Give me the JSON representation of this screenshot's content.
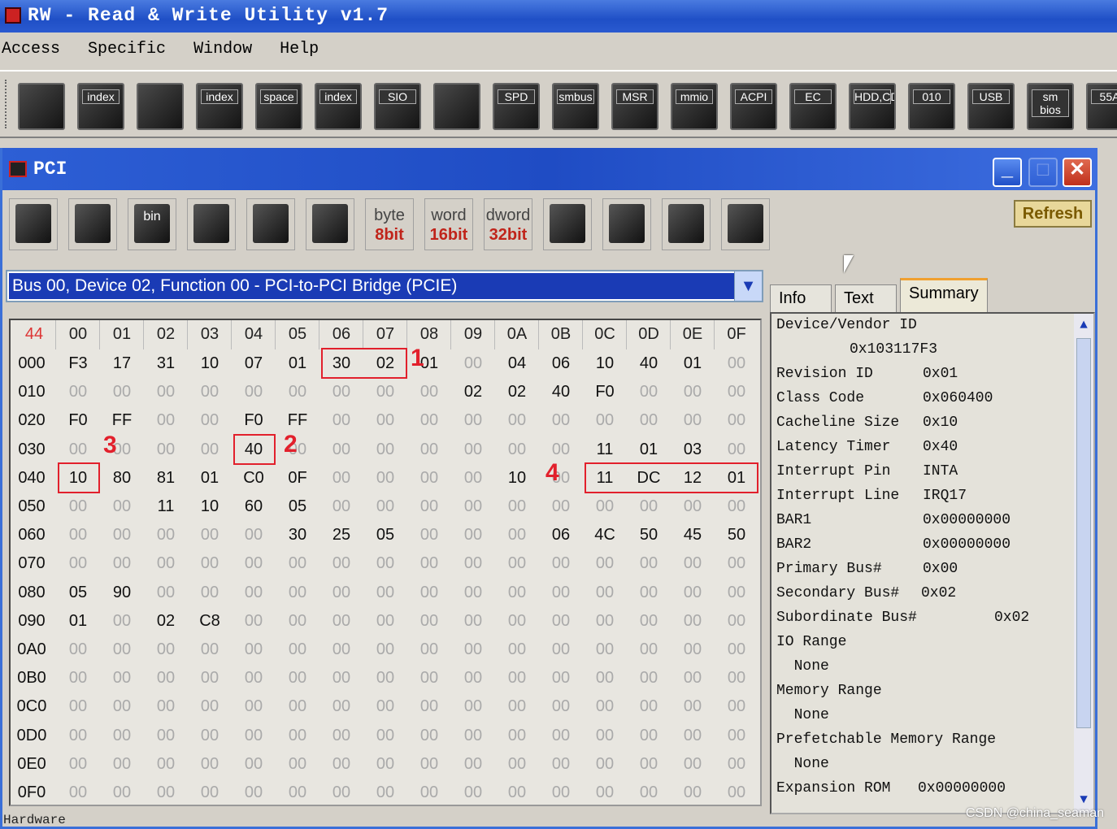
{
  "app": {
    "title": "RW - Read & Write Utility v1.7"
  },
  "menu": [
    "Access",
    "Specific",
    "Window",
    "Help"
  ],
  "toolbar": [
    {
      "label": "",
      "icon": "pci-card-icon"
    },
    {
      "label": "index",
      "icon": "index-icon"
    },
    {
      "label": "",
      "icon": "memory-icon"
    },
    {
      "label": "index",
      "icon": "index-icon"
    },
    {
      "label": "space",
      "icon": "io-space-icon"
    },
    {
      "label": "index",
      "icon": "io-index-icon"
    },
    {
      "label": "SIO",
      "icon": "sio-icon"
    },
    {
      "label": "",
      "icon": "cmos-icon"
    },
    {
      "label": "SPD",
      "icon": "spd-icon"
    },
    {
      "label": "smbus",
      "icon": "smbus-icon"
    },
    {
      "label": "MSR",
      "icon": "msr-icon"
    },
    {
      "label": "mmio",
      "icon": "mmio-icon"
    },
    {
      "label": "ACPI",
      "icon": "acpi-icon"
    },
    {
      "label": "EC",
      "icon": "ec-icon"
    },
    {
      "label": "HDD,CD",
      "icon": "hdd-icon"
    },
    {
      "label": "010",
      "icon": "file-icon"
    },
    {
      "label": "USB",
      "icon": "usb-icon"
    },
    {
      "label": "sm bios",
      "icon": "smbios-icon"
    },
    {
      "label": "55A",
      "icon": "more-icon"
    }
  ],
  "pci_window": {
    "title": "PCI",
    "toolbar": [
      {
        "l1": "",
        "l2": "",
        "icon": "save-icon"
      },
      {
        "l1": "",
        "l2": "",
        "icon": "save-all-icon"
      },
      {
        "l1": "bin",
        "l2": "",
        "icon": "save-bin-icon"
      },
      {
        "l1": "",
        "l2": "",
        "icon": "load-icon"
      },
      {
        "l1": "",
        "l2": "",
        "icon": "find-icon"
      },
      {
        "l1": "",
        "l2": "",
        "icon": "compare-icon"
      },
      {
        "l1": "byte",
        "l2": "8bit",
        "icon": ""
      },
      {
        "l1": "word",
        "l2": "16bit",
        "icon": ""
      },
      {
        "l1": "dword",
        "l2": "32bit",
        "icon": ""
      },
      {
        "l1": "",
        "l2": "",
        "icon": "tree-icon"
      },
      {
        "l1": "",
        "l2": "",
        "icon": "gear-icon"
      },
      {
        "l1": "",
        "l2": "",
        "icon": "info-icon"
      },
      {
        "l1": "",
        "l2": "",
        "icon": "help-icon"
      }
    ],
    "refresh_label": "Refresh",
    "device": "Bus 00, Device 02, Function 00 -  PCI-to-PCI Bridge (PCIE)",
    "grid": {
      "corner": "44",
      "cols": [
        "00",
        "01",
        "02",
        "03",
        "04",
        "05",
        "06",
        "07",
        "08",
        "09",
        "0A",
        "0B",
        "0C",
        "0D",
        "0E",
        "0F"
      ],
      "rows": [
        {
          "addr": "000",
          "v": [
            "F3",
            "17",
            "31",
            "10",
            "07",
            "01",
            "30",
            "02",
            "01",
            "00",
            "04",
            "06",
            "10",
            "40",
            "01",
            "00"
          ]
        },
        {
          "addr": "010",
          "v": [
            "00",
            "00",
            "00",
            "00",
            "00",
            "00",
            "00",
            "00",
            "00",
            "02",
            "02",
            "40",
            "F0",
            "00",
            "00",
            "00"
          ]
        },
        {
          "addr": "020",
          "v": [
            "F0",
            "FF",
            "00",
            "00",
            "F0",
            "FF",
            "00",
            "00",
            "00",
            "00",
            "00",
            "00",
            "00",
            "00",
            "00",
            "00"
          ]
        },
        {
          "addr": "030",
          "v": [
            "00",
            "00",
            "00",
            "00",
            "40",
            "00",
            "00",
            "00",
            "00",
            "00",
            "00",
            "00",
            "11",
            "01",
            "03",
            "00"
          ]
        },
        {
          "addr": "040",
          "v": [
            "10",
            "80",
            "81",
            "01",
            "C0",
            "0F",
            "00",
            "00",
            "00",
            "00",
            "10",
            "00",
            "11",
            "DC",
            "12",
            "01"
          ]
        },
        {
          "addr": "050",
          "v": [
            "00",
            "00",
            "11",
            "10",
            "60",
            "05",
            "00",
            "00",
            "00",
            "00",
            "00",
            "00",
            "00",
            "00",
            "00",
            "00"
          ]
        },
        {
          "addr": "060",
          "v": [
            "00",
            "00",
            "00",
            "00",
            "00",
            "30",
            "25",
            "05",
            "00",
            "00",
            "00",
            "06",
            "4C",
            "50",
            "45",
            "50"
          ]
        },
        {
          "addr": "070",
          "v": [
            "00",
            "00",
            "00",
            "00",
            "00",
            "00",
            "00",
            "00",
            "00",
            "00",
            "00",
            "00",
            "00",
            "00",
            "00",
            "00"
          ]
        },
        {
          "addr": "080",
          "v": [
            "05",
            "90",
            "00",
            "00",
            "00",
            "00",
            "00",
            "00",
            "00",
            "00",
            "00",
            "00",
            "00",
            "00",
            "00",
            "00"
          ]
        },
        {
          "addr": "090",
          "v": [
            "01",
            "00",
            "02",
            "C8",
            "00",
            "00",
            "00",
            "00",
            "00",
            "00",
            "00",
            "00",
            "00",
            "00",
            "00",
            "00"
          ]
        },
        {
          "addr": "0A0",
          "v": [
            "00",
            "00",
            "00",
            "00",
            "00",
            "00",
            "00",
            "00",
            "00",
            "00",
            "00",
            "00",
            "00",
            "00",
            "00",
            "00"
          ]
        },
        {
          "addr": "0B0",
          "v": [
            "00",
            "00",
            "00",
            "00",
            "00",
            "00",
            "00",
            "00",
            "00",
            "00",
            "00",
            "00",
            "00",
            "00",
            "00",
            "00"
          ]
        },
        {
          "addr": "0C0",
          "v": [
            "00",
            "00",
            "00",
            "00",
            "00",
            "00",
            "00",
            "00",
            "00",
            "00",
            "00",
            "00",
            "00",
            "00",
            "00",
            "00"
          ]
        },
        {
          "addr": "0D0",
          "v": [
            "00",
            "00",
            "00",
            "00",
            "00",
            "00",
            "00",
            "00",
            "00",
            "00",
            "00",
            "00",
            "00",
            "00",
            "00",
            "00"
          ]
        },
        {
          "addr": "0E0",
          "v": [
            "00",
            "00",
            "00",
            "00",
            "00",
            "00",
            "00",
            "00",
            "00",
            "00",
            "00",
            "00",
            "00",
            "00",
            "00",
            "00"
          ]
        },
        {
          "addr": "0F0",
          "v": [
            "00",
            "00",
            "00",
            "00",
            "00",
            "00",
            "00",
            "00",
            "00",
            "00",
            "00",
            "00",
            "00",
            "00",
            "00",
            "00"
          ]
        }
      ]
    },
    "annotations": [
      {
        "label": "1",
        "row": 0,
        "col_start": 6,
        "col_end": 7
      },
      {
        "label": "2",
        "row": 3,
        "col_start": 4,
        "col_end": 4
      },
      {
        "label": "3",
        "row": 4,
        "col_start": 0,
        "col_end": 0
      },
      {
        "label": "4",
        "row": 4,
        "col_start": 12,
        "col_end": 15
      }
    ],
    "tabs": [
      "Info",
      "Text",
      "Summary"
    ],
    "active_tab": "Summary",
    "summary": [
      {
        "k": "Device/Vendor ID",
        "v": ""
      },
      {
        "k": "",
        "v": "0x103117F3"
      },
      {
        "k": "Revision ID",
        "v": "0x01"
      },
      {
        "k": "Class Code",
        "v": "0x060400"
      },
      {
        "k": "Cacheline Size",
        "v": "0x10"
      },
      {
        "k": "Latency Timer",
        "v": "0x40"
      },
      {
        "k": "Interrupt Pin",
        "v": "INTA"
      },
      {
        "k": "Interrupt Line",
        "v": "IRQ17"
      },
      {
        "k": "BAR1",
        "v": "0x00000000"
      },
      {
        "k": "BAR2",
        "v": "0x00000000"
      },
      {
        "k": "Primary Bus#",
        "v": "0x00"
      },
      {
        "k": "Secondary Bus#",
        "v": "0x02"
      },
      {
        "k": "Subordinate Bus#",
        "v": "0x02"
      },
      {
        "k": "IO Range",
        "v": ""
      },
      {
        "k": "  None",
        "v": ""
      },
      {
        "k": "Memory Range",
        "v": ""
      },
      {
        "k": "  None",
        "v": ""
      },
      {
        "k": "Prefetchable Memory Range",
        "v": ""
      },
      {
        "k": "  None",
        "v": ""
      },
      {
        "k": "Expansion ROM",
        "v": "0x00000000"
      }
    ]
  },
  "status": "Hardware",
  "watermark": "CSDN @china_seaman"
}
